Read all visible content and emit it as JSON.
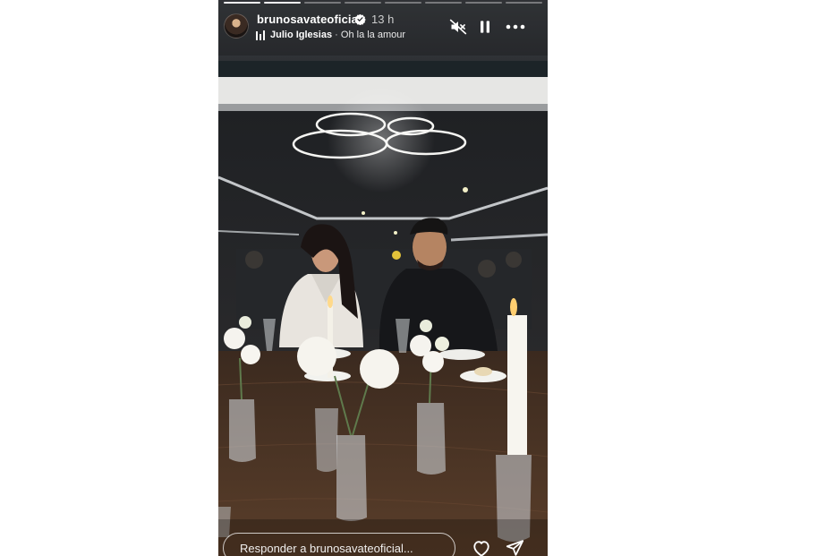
{
  "story": {
    "username": "brunosavateoficial",
    "verified": true,
    "time_ago": "13 h",
    "music": {
      "artist": "Julio Iglesias",
      "separator": "·",
      "song": "Oh la la amour"
    },
    "progress": {
      "segments_total": 8,
      "segments_viewed": 2
    },
    "reply": {
      "placeholder": "Responder a brunosavateoficial..."
    }
  },
  "icons": {
    "mute": "speaker-muted-icon",
    "pause": "pause-icon",
    "more": "more-options-icon",
    "verified": "verified-badge-icon",
    "music": "music-bars-icon",
    "like": "heart-icon",
    "share": "send-icon"
  },
  "colors": {
    "background": "#ffffff",
    "story_background": "#1c1d20",
    "overlay_text": "#ffffff",
    "verified_badge": "#ffffff"
  }
}
